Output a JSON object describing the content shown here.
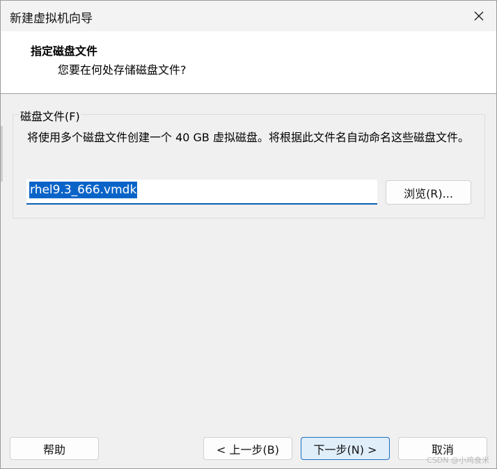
{
  "window": {
    "title": "新建虚拟机向导"
  },
  "header": {
    "title": "指定磁盘文件",
    "subtitle": "您要在何处存储磁盘文件?"
  },
  "disk_group": {
    "label": "磁盘文件(F)",
    "description": "将使用多个磁盘文件创建一个 40 GB 虚拟磁盘。将根据此文件名自动命名这些磁盘文件。",
    "filename_value": "rhel9.3_666.vmdk",
    "browse_label": "浏览(R)..."
  },
  "footer": {
    "help_label": "帮助",
    "back_label": "< 上一步(B)",
    "next_label": "下一步(N) >",
    "cancel_label": "取消"
  },
  "watermark": "CSDN @小鸡食米",
  "colors": {
    "selection": "#0a64c8",
    "primary_border": "#1a6fc4",
    "primary_bg": "#e0eefa"
  }
}
